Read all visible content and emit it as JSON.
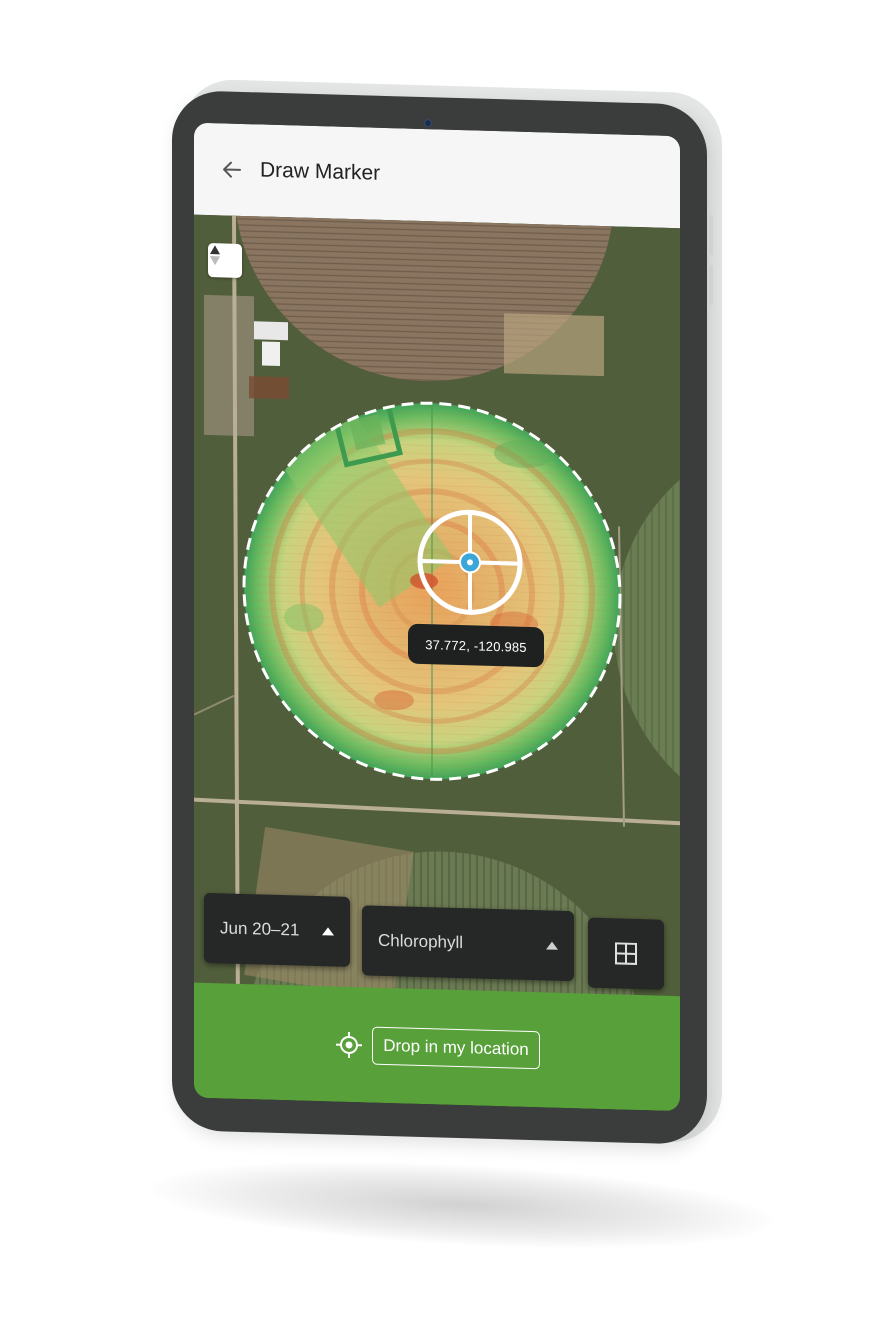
{
  "app": {
    "title": "Draw Marker"
  },
  "map": {
    "coordinates_label": "37.772,  -120.985"
  },
  "controls": {
    "date_range": "Jun 20–21",
    "layer": "Chlorophyll"
  },
  "action": {
    "drop_label": "Drop in my location"
  },
  "icons": {
    "back": "arrow-left-icon",
    "compass": "compass-icon",
    "dropdown": "caret-up-icon",
    "grid": "grid-icon",
    "locate": "my-location-icon"
  },
  "colors": {
    "accent_green": "#58a03a",
    "control_dark": "#262827",
    "marker_cyan": "#3aa7d6"
  }
}
